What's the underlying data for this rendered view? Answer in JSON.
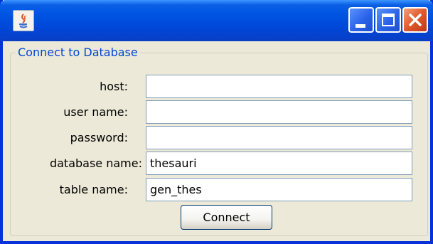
{
  "window": {
    "title": "",
    "controls": {
      "minimize_icon": "minimize-icon",
      "maximize_icon": "maximize-icon",
      "close_icon": "close-icon"
    },
    "colors": {
      "titlebar": "#0054e3",
      "frame": "#0831d9",
      "close_button": "#e05a2b",
      "panel": "#ece9d8"
    }
  },
  "form": {
    "group_title": "Connect to Database",
    "fields": [
      {
        "label": "host:",
        "value": ""
      },
      {
        "label": "user name:",
        "value": ""
      },
      {
        "label": "password:",
        "value": ""
      },
      {
        "label": "database name:",
        "value": "thesauri"
      },
      {
        "label": "table name:",
        "value": "gen_thes"
      }
    ],
    "connect_label": "Connect"
  }
}
